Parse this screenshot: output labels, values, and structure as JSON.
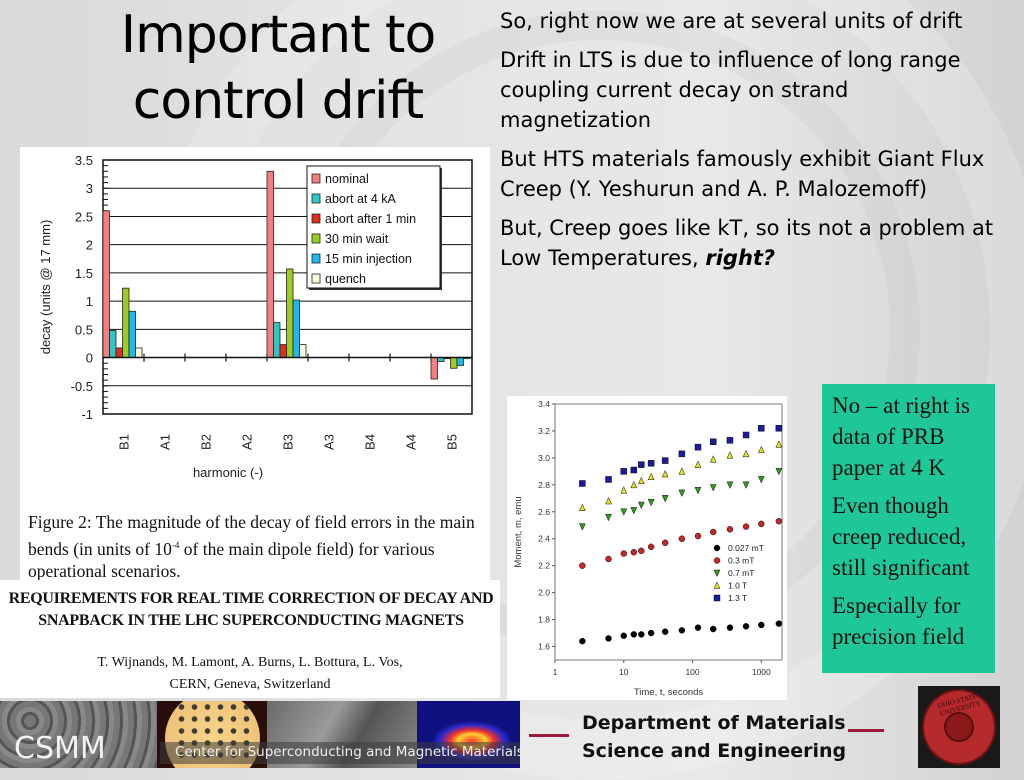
{
  "slide": {
    "title": "Important to control drift",
    "bullets": [
      "So, right now we are at several units of drift",
      "Drift in LTS is due to influence of long range coupling current decay on strand magnetization",
      "But HTS materials famously exhibit Giant Flux Creep (Y. Yeshurun and A. P. Malozemoff)"
    ],
    "bullet4_prefix": "But, Creep goes like kT, so its not a problem at Low Temperatures, ",
    "bullet4_emphasis": "right?",
    "note_box": {
      "color": "#1fc697",
      "paragraphs": [
        "No – at right is data of PRB paper at 4 K",
        "Even though creep reduced, still significant",
        "Especially for precision field"
      ]
    },
    "caption": {
      "prefix": "Figure 2: The magnitude of the decay of field errors in the main bends (in units of 10",
      "sup": "-4",
      "suffix": " of the main dipole field) for various operational scenarios."
    },
    "paper": {
      "title_line1": "REQUIREMENTS FOR REAL TIME CORRECTION OF DECAY AND",
      "title_line2": "SNAPBACK IN THE LHC SUPERCONDUCTING MAGNETS",
      "authors": "T. Wijnands, M. Lamont, A. Burns, L. Bottura, L. Vos,",
      "affiliation": "CERN, Geneva, Switzerland"
    },
    "footer": {
      "logo_text": "CSMM",
      "center_name": "Center for Superconducting and Magnetic Materials",
      "dept_line1": "Department of Materials",
      "dept_line2": "Science and Engineering",
      "accent_color": "#9b1b3b",
      "seal_text": "OHIO STATE UNIVERSITY"
    }
  },
  "chart_data": [
    {
      "type": "bar",
      "title": "",
      "xlabel": "harmonic (-)",
      "ylabel": "decay (units @ 17 mm)",
      "ylim": [
        -1,
        3.5
      ],
      "yticks": [
        "3.5",
        "3",
        "2.5",
        "2",
        "1.5",
        "1",
        "0.5",
        "0",
        "-0.5",
        "-1"
      ],
      "ytick_values": [
        3.5,
        3,
        2.5,
        2,
        1.5,
        1,
        0.5,
        0,
        -0.5,
        -1
      ],
      "grid": true,
      "legend": "top-right",
      "categories": [
        "B1",
        "A1",
        "B2",
        "A2",
        "B3",
        "A3",
        "B4",
        "A4",
        "B5"
      ],
      "series": [
        {
          "name": "nominal",
          "color": "#f47f7f",
          "values": [
            2.6,
            0,
            0,
            0,
            3.3,
            0,
            0,
            0,
            -0.38
          ]
        },
        {
          "name": "abort at 4 kA",
          "color": "#2fc6c6",
          "values": [
            0.48,
            0,
            0,
            0,
            0.62,
            0,
            0,
            0,
            -0.07
          ]
        },
        {
          "name": "abort after 1 min",
          "color": "#e8291c",
          "values": [
            0.17,
            0,
            0,
            0,
            0.23,
            0,
            0,
            0,
            -0.02
          ]
        },
        {
          "name": "30 min wait",
          "color": "#9ccc1c",
          "values": [
            1.23,
            0,
            0,
            0,
            1.57,
            0,
            0,
            0,
            -0.19
          ]
        },
        {
          "name": "15 min injection",
          "color": "#20b8ea",
          "values": [
            0.82,
            0,
            0,
            0,
            1.02,
            0,
            0,
            0,
            -0.14
          ]
        },
        {
          "name": "quench",
          "color": "#fdfbdc",
          "values": [
            0.17,
            0,
            0,
            0,
            0.23,
            0,
            0,
            0,
            -0.02
          ]
        }
      ]
    },
    {
      "type": "scatter",
      "title": "",
      "xlabel": "Time, t, seconds",
      "ylabel": "Moment, m, emu",
      "xscale": "log",
      "xlim": [
        1,
        2000
      ],
      "ylim": [
        1.5,
        3.4
      ],
      "xticks": [
        "1",
        "10",
        "100",
        "1000"
      ],
      "xtick_values": [
        1,
        10,
        100,
        1000
      ],
      "yticks": [
        "1.6",
        "1.8",
        "2.0",
        "2.2",
        "2.4",
        "2.6",
        "2.8",
        "3.0",
        "3.2",
        "3.4"
      ],
      "ytick_values": [
        1.6,
        1.8,
        2.0,
        2.2,
        2.4,
        2.6,
        2.8,
        3.0,
        3.2,
        3.4
      ],
      "legend": "center-right",
      "series": [
        {
          "name": "0.027 mT",
          "marker": "circle",
          "color": "#000000",
          "x": [
            2.5,
            6,
            10,
            14,
            18,
            25,
            40,
            70,
            120,
            200,
            350,
            600,
            1000,
            1800
          ],
          "y": [
            1.64,
            1.66,
            1.68,
            1.69,
            1.69,
            1.7,
            1.71,
            1.72,
            1.74,
            1.73,
            1.74,
            1.75,
            1.76,
            1.77
          ]
        },
        {
          "name": "0.3 mT",
          "marker": "circle",
          "color": "#c0282a",
          "x": [
            2.5,
            6,
            10,
            14,
            18,
            25,
            40,
            70,
            120,
            200,
            350,
            600,
            1000,
            1800
          ],
          "y": [
            2.2,
            2.25,
            2.29,
            2.3,
            2.31,
            2.34,
            2.37,
            2.4,
            2.42,
            2.45,
            2.47,
            2.49,
            2.51,
            2.53
          ]
        },
        {
          "name": "0.7 mT",
          "marker": "triangle-down",
          "color": "#2e9e1c",
          "x": [
            2.5,
            6,
            10,
            14,
            18,
            25,
            40,
            70,
            120,
            200,
            350,
            600,
            1000,
            1800
          ],
          "y": [
            2.49,
            2.56,
            2.6,
            2.61,
            2.65,
            2.67,
            2.7,
            2.74,
            2.76,
            2.78,
            2.8,
            2.8,
            2.84,
            2.9
          ]
        },
        {
          "name": "1.0 T",
          "marker": "triangle-up",
          "color": "#e0dc2a",
          "x": [
            2.5,
            6,
            10,
            14,
            18,
            25,
            40,
            70,
            120,
            200,
            350,
            600,
            1000,
            1800
          ],
          "y": [
            2.63,
            2.68,
            2.76,
            2.8,
            2.83,
            2.86,
            2.88,
            2.9,
            2.95,
            2.99,
            3.02,
            3.03,
            3.06,
            3.1
          ]
        },
        {
          "name": "1.3 T",
          "marker": "square",
          "color": "#1a1aa0",
          "x": [
            2.5,
            6,
            10,
            14,
            18,
            25,
            40,
            70,
            120,
            200,
            350,
            600,
            1000,
            1800
          ],
          "y": [
            2.81,
            2.84,
            2.9,
            2.91,
            2.95,
            2.96,
            2.98,
            3.03,
            3.08,
            3.12,
            3.13,
            3.17,
            3.22,
            3.22
          ]
        }
      ]
    }
  ]
}
